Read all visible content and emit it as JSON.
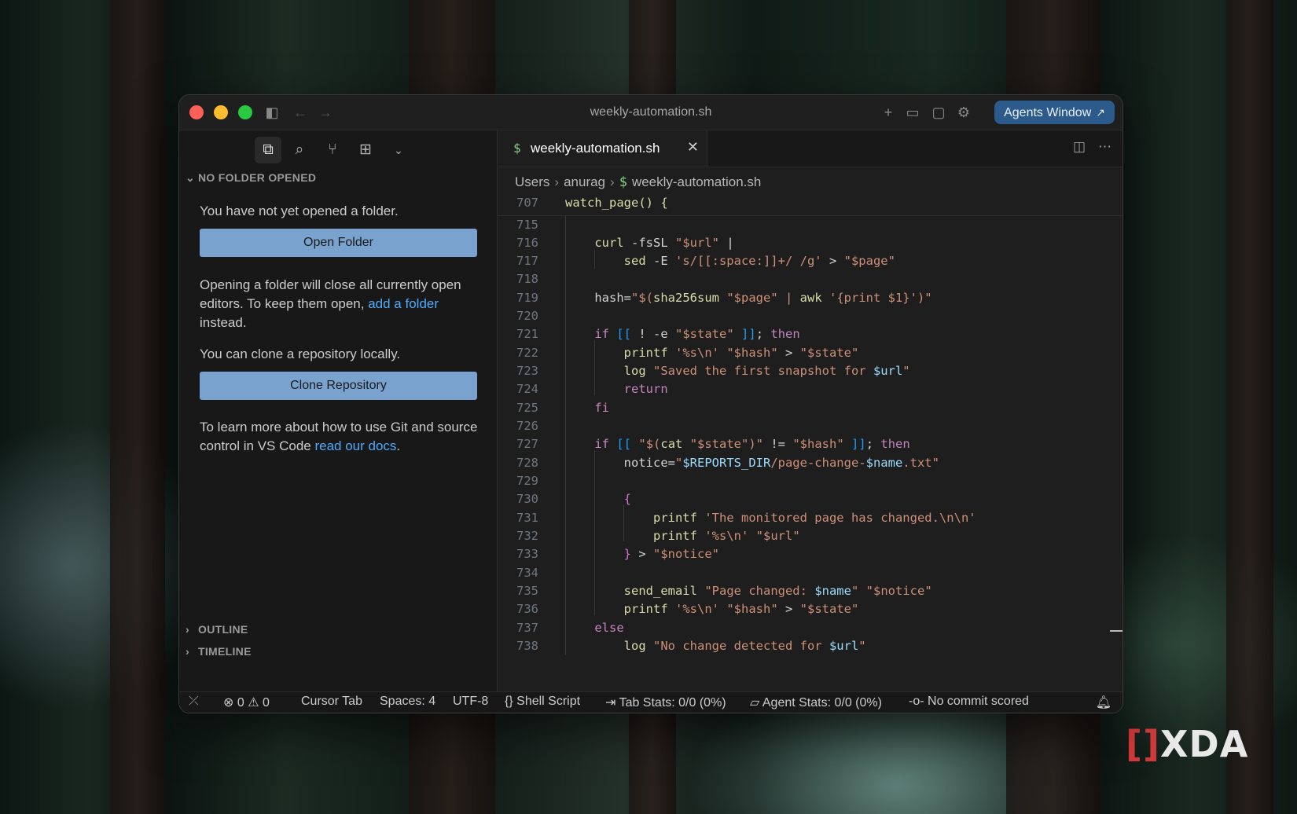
{
  "window": {
    "title": "weekly-automation.sh"
  },
  "titlebar": {
    "agents_button": "Agents Window",
    "agents_arrow": "↗"
  },
  "sidebar": {
    "section_title": "NO FOLDER OPENED",
    "not_opened_text": "You have not yet opened a folder.",
    "open_folder_button": "Open Folder",
    "opening_text_1": "Opening a folder will close all currently open editors. To keep them open, ",
    "add_folder_link": "add a folder",
    "opening_text_2": " instead.",
    "clone_text": "You can clone a repository locally.",
    "clone_button": "Clone Repository",
    "learn_text_1": "To learn more about how to use Git and source control in VS Code ",
    "docs_link": "read our docs",
    "learn_text_2": ".",
    "outline": "OUTLINE",
    "timeline": "TIMELINE"
  },
  "editor": {
    "tab_label": "weekly-automation.sh",
    "tab_icon": "$",
    "breadcrumb": {
      "part1": "Users",
      "part2": "anurag",
      "part3": "weekly-automation.sh"
    },
    "sticky": {
      "number": "707",
      "code": "watch_page() {"
    },
    "lines": [
      {
        "n": "715"
      },
      {
        "n": "716"
      },
      {
        "n": "717"
      },
      {
        "n": "718"
      },
      {
        "n": "719"
      },
      {
        "n": "720"
      },
      {
        "n": "721"
      },
      {
        "n": "722"
      },
      {
        "n": "723"
      },
      {
        "n": "724"
      },
      {
        "n": "725"
      },
      {
        "n": "726"
      },
      {
        "n": "727"
      },
      {
        "n": "728"
      },
      {
        "n": "729"
      },
      {
        "n": "730"
      },
      {
        "n": "731"
      },
      {
        "n": "732"
      },
      {
        "n": "733"
      },
      {
        "n": "734"
      },
      {
        "n": "735"
      },
      {
        "n": "736"
      },
      {
        "n": "737"
      },
      {
        "n": "738"
      }
    ]
  },
  "statusbar": {
    "errors": "0",
    "warnings": "0",
    "cursor_tab": "Cursor Tab",
    "spaces": "Spaces: 4",
    "encoding": "UTF-8",
    "language": "Shell Script",
    "tab_stats": "Tab Stats: 0/0 (0%)",
    "agent_stats": "Agent Stats: 0/0 (0%)",
    "commit": "No commit scored"
  },
  "watermark": {
    "brand": "XDA"
  },
  "colors": {
    "accent_button": "#7aa2cf",
    "agents_button": "#2c5a8a",
    "link": "#4daafc"
  }
}
